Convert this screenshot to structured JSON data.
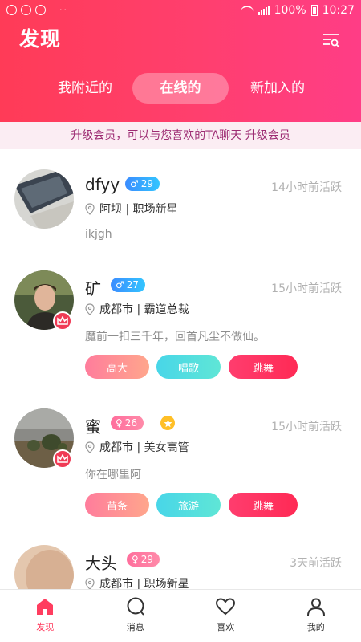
{
  "status_bar": {
    "battery": "100%",
    "time": "10:27",
    "dots": "··"
  },
  "header": {
    "title": "发现"
  },
  "tabs": [
    {
      "label": "我附近的"
    },
    {
      "label": "在线的"
    },
    {
      "label": "新加入的"
    }
  ],
  "banner": {
    "text": "升级会员，可以与您喜欢的TA聊天 ",
    "link": "升级会员"
  },
  "users": [
    {
      "name": "dfyy",
      "gender": "male",
      "age": "29",
      "active": "14小时前活跃",
      "location": "阿坝 | 职场新星",
      "signature": "ikjgh",
      "tags": []
    },
    {
      "name": "矿",
      "gender": "male",
      "age": "27",
      "active": "15小时前活跃",
      "location": "成都市 | 霸道总裁",
      "signature": "魔前一扣三千年，回首凡尘不做仙。",
      "tags": [
        "高大",
        "唱歌",
        "跳舞"
      ]
    },
    {
      "name": "蜜",
      "gender": "female",
      "age": "26",
      "active": "15小时前活跃",
      "location": "成都市 | 美女高管",
      "signature": "你在哪里阿",
      "tags": [
        "苗条",
        "旅游",
        "跳舞"
      ]
    },
    {
      "name": "大头",
      "gender": "female",
      "age": "29",
      "active": "3天前活跃",
      "location": "成都市 | 职场新星",
      "signature": "",
      "tags": []
    }
  ],
  "bottom_nav": [
    {
      "label": "发现",
      "icon": "home-icon",
      "active": true
    },
    {
      "label": "消息",
      "icon": "message-icon",
      "active": false
    },
    {
      "label": "喜欢",
      "icon": "heart-icon",
      "active": false
    },
    {
      "label": "我的",
      "icon": "profile-icon",
      "active": false
    }
  ],
  "colors": {
    "accent": "#ff3d5f",
    "header_start": "#ff3b57",
    "header_end": "#ff3d86",
    "banner_bg": "#fbedf3"
  }
}
